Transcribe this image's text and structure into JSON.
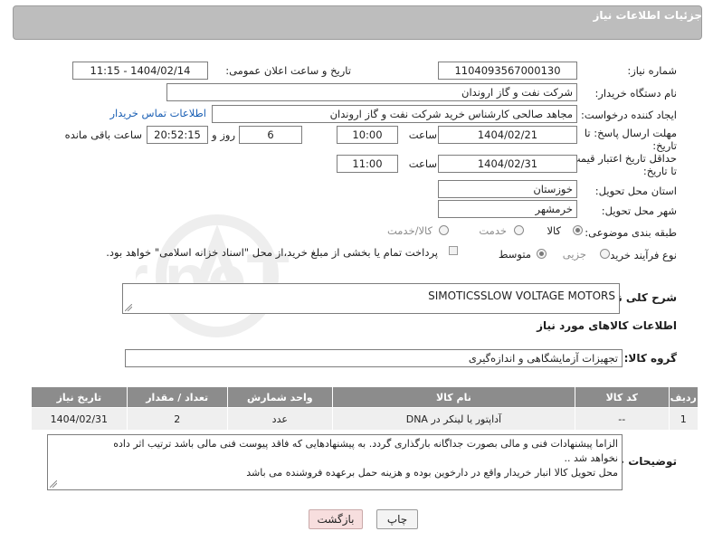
{
  "panel_title": "جزئیات اطلاعات نیاز",
  "need_number": {
    "label": "شماره نیاز:",
    "value": "1104093567000130"
  },
  "announce_datetime": {
    "label": "تاریخ و ساعت اعلان عمومی:",
    "value": "1404/02/14 - 11:15"
  },
  "buyer_org": {
    "label": "نام دستگاه خریدار:",
    "value": "شرکت نفت و گاز اروندان"
  },
  "requester": {
    "label": "ایجاد کننده درخواست:",
    "value": "مجاهد صالحی کارشناس خرید شرکت نفت و گاز اروندان",
    "contact_link": "اطلاعات تماس خریدار"
  },
  "reply_deadline": {
    "label_line1": "مهلت ارسال پاسخ: تا",
    "label_line2": "تاریخ:",
    "date": "1404/02/21",
    "time_label": "ساعت",
    "time": "10:00",
    "days": "6",
    "days_label": "روز و",
    "remaining": "20:52:15",
    "remaining_label": "ساعت باقی مانده"
  },
  "price_validity": {
    "label_line1": "حداقل تاریخ اعتبار قیمت:",
    "label_line2": "تا تاریخ:",
    "date": "1404/02/31",
    "time_label": "ساعت",
    "time": "11:00"
  },
  "province": {
    "label": "استان محل تحویل:",
    "value": "خوزستان"
  },
  "city": {
    "label": "شهر محل تحویل:",
    "value": "خرمشهر"
  },
  "category": {
    "label": "طبقه بندی موضوعی:",
    "options": [
      "کالا",
      "خدمت",
      "کالا/خدمت"
    ],
    "selected": "کالا"
  },
  "purchase_process": {
    "label": "نوع فرآیند خرید :",
    "options": [
      "جزیی",
      "متوسط"
    ],
    "selected": "متوسط",
    "note": "پرداخت تمام یا بخشی از مبلغ خرید،از محل \"اسناد خزانه اسلامی\" خواهد بود."
  },
  "general_description": {
    "label": "شرح کلی نیاز:",
    "value": "SIMOTICSSLOW VOLTAGE MOTORS"
  },
  "items_section_title": "اطلاعات کالاهای مورد نیاز",
  "goods_group": {
    "label": "گروه کالا:",
    "value": "تجهیزات آزمایشگاهی و اندازه‌گیری"
  },
  "items_table": {
    "headers": [
      "ردیف",
      "کد کالا",
      "نام کالا",
      "واحد شمارش",
      "تعداد / مقدار",
      "تاریخ نیاز"
    ],
    "rows": [
      [
        "1",
        "--",
        "آداپتور یا لینکر در DNA",
        "عدد",
        "2",
        "1404/02/31"
      ]
    ]
  },
  "buyer_notes": {
    "label": "توضیحات خریدار:",
    "line1": "الزاما  پیشنهادات فنی و مالی بصورت جداگانه بارگذاری گردد. به پیشنهادهایی که فاقد پیوست فنی مالی باشد ترتیب اثر داده",
    "line2": "نخواهد شد ..",
    "line3": "محل تحویل کالا انبار خریدار واقع در  دارخوین بوده و هزینه حمل برعهده فروشنده می باشد"
  },
  "buttons": {
    "print": "چاپ",
    "back": "بازگشت"
  },
  "watermark": "AriaTender.neT"
}
